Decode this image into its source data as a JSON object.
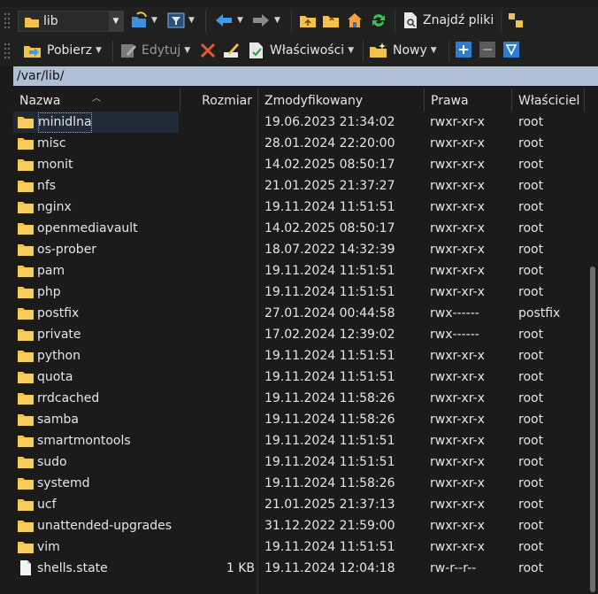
{
  "toolbar1": {
    "location_value": "lib",
    "find_files_label": "Znajdź pliki"
  },
  "toolbar2": {
    "download_label": "Pobierz",
    "edit_label": "Edytuj",
    "properties_label": "Właściwości",
    "new_label": "Nowy"
  },
  "path": "/var/lib/",
  "columns": {
    "name": "Nazwa",
    "size": "Rozmiar",
    "modified": "Zmodyfikowany",
    "permissions": "Prawa",
    "owner": "Właściciel"
  },
  "files": [
    {
      "name": "minidlna",
      "size": "",
      "modified": "19.06.2023 21:34:02",
      "perm": "rwxr-xr-x",
      "owner": "root",
      "type": "folder"
    },
    {
      "name": "misc",
      "size": "",
      "modified": "28.01.2024 22:20:00",
      "perm": "rwxr-xr-x",
      "owner": "root",
      "type": "folder"
    },
    {
      "name": "monit",
      "size": "",
      "modified": "14.02.2025 08:50:17",
      "perm": "rwxr-xr-x",
      "owner": "root",
      "type": "folder"
    },
    {
      "name": "nfs",
      "size": "",
      "modified": "21.01.2025 21:37:27",
      "perm": "rwxr-xr-x",
      "owner": "root",
      "type": "folder"
    },
    {
      "name": "nginx",
      "size": "",
      "modified": "19.11.2024 11:51:51",
      "perm": "rwxr-xr-x",
      "owner": "root",
      "type": "folder"
    },
    {
      "name": "openmediavault",
      "size": "",
      "modified": "14.02.2025 08:50:17",
      "perm": "rwxr-xr-x",
      "owner": "root",
      "type": "folder"
    },
    {
      "name": "os-prober",
      "size": "",
      "modified": "18.07.2022 14:32:39",
      "perm": "rwxr-xr-x",
      "owner": "root",
      "type": "folder"
    },
    {
      "name": "pam",
      "size": "",
      "modified": "19.11.2024 11:51:51",
      "perm": "rwxr-xr-x",
      "owner": "root",
      "type": "folder"
    },
    {
      "name": "php",
      "size": "",
      "modified": "19.11.2024 11:51:51",
      "perm": "rwxr-xr-x",
      "owner": "root",
      "type": "folder"
    },
    {
      "name": "postfix",
      "size": "",
      "modified": "27.01.2024 00:44:58",
      "perm": "rwx------",
      "owner": "postfix",
      "type": "folder"
    },
    {
      "name": "private",
      "size": "",
      "modified": "17.02.2024 12:39:02",
      "perm": "rwx------",
      "owner": "root",
      "type": "folder"
    },
    {
      "name": "python",
      "size": "",
      "modified": "19.11.2024 11:51:51",
      "perm": "rwxr-xr-x",
      "owner": "root",
      "type": "folder"
    },
    {
      "name": "quota",
      "size": "",
      "modified": "19.11.2024 11:51:51",
      "perm": "rwxr-xr-x",
      "owner": "root",
      "type": "folder"
    },
    {
      "name": "rrdcached",
      "size": "",
      "modified": "19.11.2024 11:58:26",
      "perm": "rwxr-xr-x",
      "owner": "root",
      "type": "folder"
    },
    {
      "name": "samba",
      "size": "",
      "modified": "19.11.2024 11:58:26",
      "perm": "rwxr-xr-x",
      "owner": "root",
      "type": "folder"
    },
    {
      "name": "smartmontools",
      "size": "",
      "modified": "19.11.2024 11:51:51",
      "perm": "rwxr-xr-x",
      "owner": "root",
      "type": "folder"
    },
    {
      "name": "sudo",
      "size": "",
      "modified": "19.11.2024 11:51:51",
      "perm": "rwxr-xr-x",
      "owner": "root",
      "type": "folder"
    },
    {
      "name": "systemd",
      "size": "",
      "modified": "19.11.2024 11:58:26",
      "perm": "rwxr-xr-x",
      "owner": "root",
      "type": "folder"
    },
    {
      "name": "ucf",
      "size": "",
      "modified": "21.01.2025 21:37:13",
      "perm": "rwxr-xr-x",
      "owner": "root",
      "type": "folder"
    },
    {
      "name": "unattended-upgrades",
      "size": "",
      "modified": "31.12.2022 21:59:00",
      "perm": "rwxr-xr-x",
      "owner": "root",
      "type": "folder"
    },
    {
      "name": "vim",
      "size": "",
      "modified": "19.11.2024 11:51:51",
      "perm": "rwxr-xr-x",
      "owner": "root",
      "type": "folder"
    },
    {
      "name": "shells.state",
      "size": "1 KB",
      "modified": "19.11.2024 12:04:18",
      "perm": "rw-r--r--",
      "owner": "root",
      "type": "file"
    }
  ],
  "colors": {
    "background": "#1b1b1b",
    "path_bar": "#aebfd6",
    "folder": "#f2c14e",
    "selection": "#1f2a38"
  }
}
